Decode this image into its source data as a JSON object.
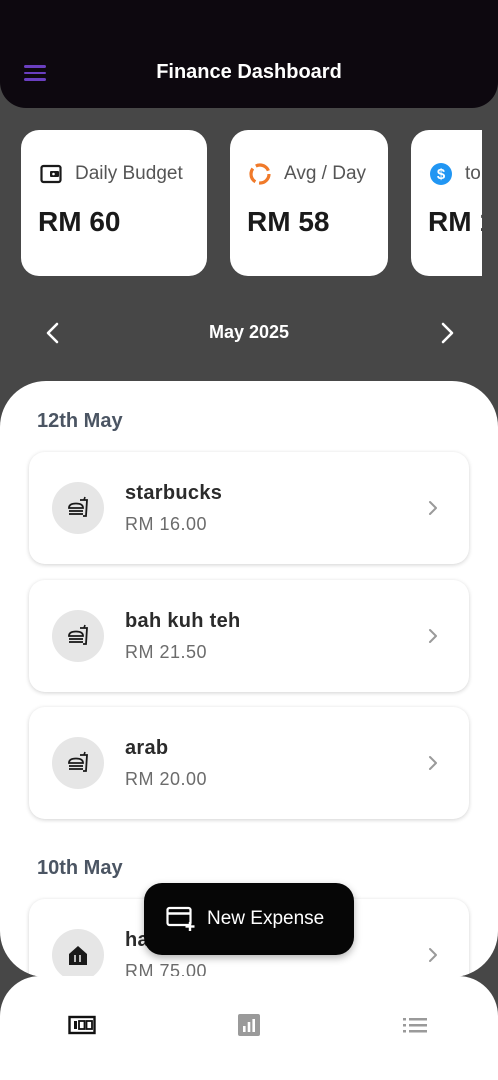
{
  "app_bar": {
    "title": "Finance Dashboard",
    "menu_icon": "hamburger-menu-icon",
    "menu_color": "#6a3fc0"
  },
  "stat_cards": [
    {
      "icon": "wallet-icon",
      "label": "Daily Budget",
      "value": "RM 60"
    },
    {
      "icon": "donut-chart-icon",
      "label": "Avg / Day",
      "value": "RM 58",
      "icon_color": "#f07a2a"
    },
    {
      "icon": "dollar-circle-icon",
      "label": "to",
      "value": "RM 1",
      "icon_color": "#2196f3"
    }
  ],
  "month_nav": {
    "label": "May 2025",
    "prev_icon": "chevron-left-icon",
    "next_icon": "chevron-right-icon"
  },
  "groups": [
    {
      "date": "12th May",
      "items": [
        {
          "name": "starbucks",
          "amount": "RM 16.00",
          "icon": "fastfood-icon"
        },
        {
          "name": "bah kuh teh",
          "amount": "RM 21.50",
          "icon": "fastfood-icon"
        },
        {
          "name": "arab",
          "amount": "RM 20.00",
          "icon": "fastfood-icon"
        }
      ]
    },
    {
      "date": "10th May",
      "items": [
        {
          "name": "ha",
          "amount": "RM 75.00",
          "icon": "house-icon"
        }
      ]
    }
  ],
  "fab": {
    "label": "New Expense",
    "icon": "add-card-icon"
  },
  "bottom_nav": [
    {
      "icon": "money-icon",
      "selected": true
    },
    {
      "icon": "bar-chart-icon",
      "selected": false
    },
    {
      "icon": "list-icon",
      "selected": false
    }
  ]
}
